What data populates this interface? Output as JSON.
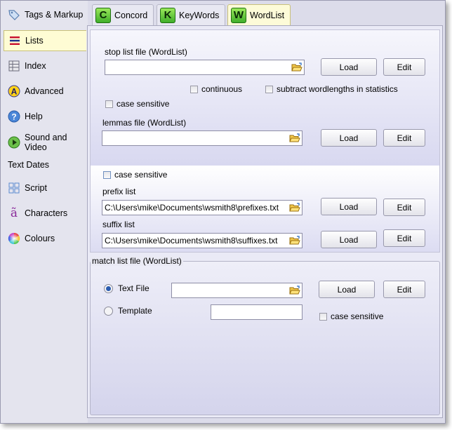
{
  "sidebar": {
    "items": [
      {
        "label": "Tags & Markup",
        "icon": "tag-icon"
      },
      {
        "label": "Lists",
        "icon": "lists-icon",
        "active": true
      },
      {
        "label": "Index",
        "icon": "index-icon"
      },
      {
        "label": "Advanced",
        "icon": "advanced-icon"
      },
      {
        "label": "Help",
        "icon": "help-icon"
      },
      {
        "label": "Sound and Video",
        "icon": "play-icon"
      },
      {
        "label": "Text Dates",
        "icon": ""
      },
      {
        "label": "Script",
        "icon": "script-grid-icon"
      },
      {
        "label": "Characters",
        "icon": "characters-icon"
      },
      {
        "label": "Colours",
        "icon": "colours-icon"
      }
    ]
  },
  "tabs": [
    {
      "label": "Concord",
      "letter": "C"
    },
    {
      "label": "KeyWords",
      "letter": "K"
    },
    {
      "label": "WordList",
      "letter": "W",
      "active": true
    }
  ],
  "stoplist": {
    "label": "stop list file (WordList)",
    "value": "",
    "load": "Load",
    "edit": "Edit",
    "continuous": "continuous",
    "subtract": "subtract wordlengths in statistics",
    "case_sensitive": "case sensitive"
  },
  "lemmas": {
    "label": "lemmas file (WordList)",
    "value": "",
    "load": "Load",
    "edit": "Edit"
  },
  "affix": {
    "case_sensitive": "case sensitive",
    "prefix_label": "prefix list",
    "prefix_value": "C:\\Users\\mike\\Documents\\wsmith8\\prefixes.txt",
    "suffix_label": "suffix list",
    "suffix_value": "C:\\Users\\mike\\Documents\\wsmith8\\suffixes.txt",
    "load": "Load",
    "edit": "Edit"
  },
  "matchlist": {
    "legend": "match list file (WordList)",
    "text_file": "Text File",
    "template": "Template",
    "text_file_value": "",
    "template_value": "",
    "load": "Load",
    "edit": "Edit",
    "case_sensitive": "case sensitive"
  }
}
